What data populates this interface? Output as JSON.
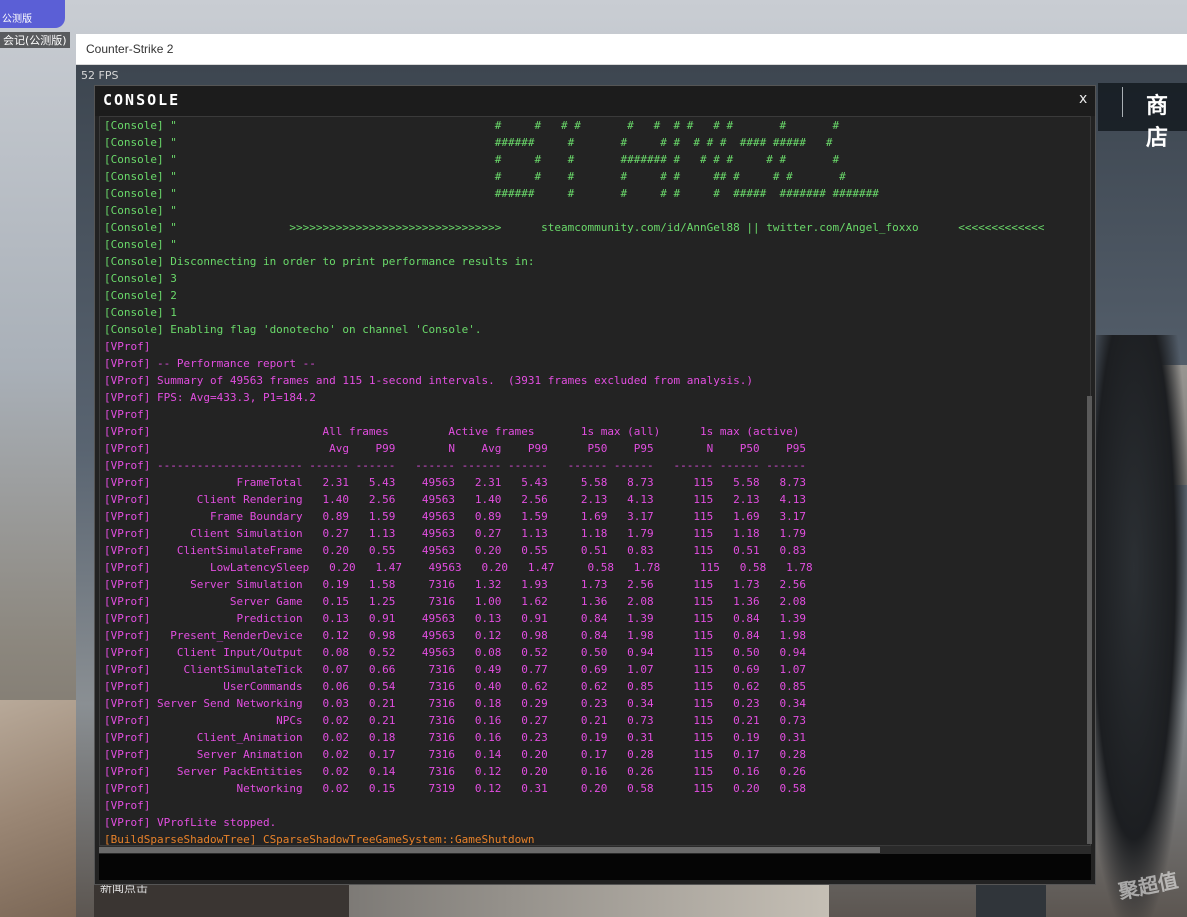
{
  "desktop": {
    "icon_sub_label": "公测版",
    "icon_label": "会记(公测版)"
  },
  "window": {
    "title": "Counter-Strike 2"
  },
  "game": {
    "fps": "52 FPS",
    "store_label": "商店",
    "news_text": "新闻点击",
    "watermark": "聚超值"
  },
  "console": {
    "title": "CONSOLE",
    "close_label": "x",
    "colors": {
      "console_text": "#6ad96a",
      "vprof_text": "#e24ee0",
      "build_text": "#e8822a",
      "background": "#232323"
    },
    "lines": [
      {
        "t": "[Console] \"                                                #     #   # #       #   #  # #   # #       #       #",
        "c": "#6ad96a"
      },
      {
        "t": "[Console] \"                                                ######     #       #     # #  # # #  #### #####   #",
        "c": "#6ad96a"
      },
      {
        "t": "[Console] \"                                                #     #    #       ####### #   # # #     # #       #",
        "c": "#6ad96a"
      },
      {
        "t": "[Console] \"                                                #     #    #       #     # #     ## #     # #       #",
        "c": "#6ad96a"
      },
      {
        "t": "[Console] \"                                                ######     #       #     # #     #  #####  ####### #######",
        "c": "#6ad96a"
      },
      {
        "t": "[Console] \"",
        "c": "#6ad96a"
      },
      {
        "t": "[Console] \"                 >>>>>>>>>>>>>>>>>>>>>>>>>>>>>>>>      steamcommunity.com/id/AnnGel88 || twitter.com/Angel_foxxo      <<<<<<<<<<<<<",
        "c": "#6ad96a"
      },
      {
        "t": "[Console] \"",
        "c": "#6ad96a"
      },
      {
        "t": "[Console] Disconnecting in order to print performance results in:",
        "c": "#6ad96a"
      },
      {
        "t": "[Console] 3",
        "c": "#6ad96a"
      },
      {
        "t": "[Console] 2",
        "c": "#6ad96a"
      },
      {
        "t": "[Console] 1",
        "c": "#6ad96a"
      },
      {
        "t": "[Console] Enabling flag 'donotecho' on channel 'Console'.",
        "c": "#6ad96a"
      },
      {
        "t": "[VProf]",
        "c": "#e24ee0"
      },
      {
        "t": "[VProf] -- Performance report --",
        "c": "#e24ee0"
      },
      {
        "t": "[VProf] Summary of 49563 frames and 115 1-second intervals.  (3931 frames excluded from analysis.)",
        "c": "#e24ee0"
      },
      {
        "t": "[VProf] FPS: Avg=433.3, P1=184.2",
        "c": "#e24ee0"
      },
      {
        "t": "[VProf]",
        "c": "#e24ee0"
      },
      {
        "t": "[VProf]                          All frames         Active frames       1s max (all)      1s max (active)",
        "c": "#e24ee0"
      },
      {
        "t": "[VProf]                           Avg    P99        N    Avg    P99      P50    P95        N    P50    P95",
        "c": "#e24ee0"
      },
      {
        "t": "[VProf] ---------------------- ------ ------   ------ ------ ------   ------ ------   ------ ------ ------",
        "c": "#e24ee0"
      },
      {
        "t": "[VProf]             FrameTotal   2.31   5.43    49563   2.31   5.43     5.58   8.73      115   5.58   8.73",
        "c": "#e24ee0"
      },
      {
        "t": "[VProf]       Client Rendering   1.40   2.56    49563   1.40   2.56     2.13   4.13      115   2.13   4.13",
        "c": "#e24ee0"
      },
      {
        "t": "[VProf]         Frame Boundary   0.89   1.59    49563   0.89   1.59     1.69   3.17      115   1.69   3.17",
        "c": "#e24ee0"
      },
      {
        "t": "[VProf]      Client Simulation   0.27   1.13    49563   0.27   1.13     1.18   1.79      115   1.18   1.79",
        "c": "#e24ee0"
      },
      {
        "t": "[VProf]    ClientSimulateFrame   0.20   0.55    49563   0.20   0.55     0.51   0.83      115   0.51   0.83",
        "c": "#e24ee0"
      },
      {
        "t": "[VProf]         LowLatencySleep   0.20   1.47    49563   0.20   1.47     0.58   1.78      115   0.58   1.78",
        "c": "#e24ee0"
      },
      {
        "t": "[VProf]      Server Simulation   0.19   1.58     7316   1.32   1.93     1.73   2.56      115   1.73   2.56",
        "c": "#e24ee0"
      },
      {
        "t": "[VProf]            Server Game   0.15   1.25     7316   1.00   1.62     1.36   2.08      115   1.36   2.08",
        "c": "#e24ee0"
      },
      {
        "t": "[VProf]             Prediction   0.13   0.91    49563   0.13   0.91     0.84   1.39      115   0.84   1.39",
        "c": "#e24ee0"
      },
      {
        "t": "[VProf]   Present_RenderDevice   0.12   0.98    49563   0.12   0.98     0.84   1.98      115   0.84   1.98",
        "c": "#e24ee0"
      },
      {
        "t": "[VProf]    Client Input/Output   0.08   0.52    49563   0.08   0.52     0.50   0.94      115   0.50   0.94",
        "c": "#e24ee0"
      },
      {
        "t": "[VProf]     ClientSimulateTick   0.07   0.66     7316   0.49   0.77     0.69   1.07      115   0.69   1.07",
        "c": "#e24ee0"
      },
      {
        "t": "[VProf]           UserCommands   0.06   0.54     7316   0.40   0.62     0.62   0.85      115   0.62   0.85",
        "c": "#e24ee0"
      },
      {
        "t": "[VProf] Server Send Networking   0.03   0.21     7316   0.18   0.29     0.23   0.34      115   0.23   0.34",
        "c": "#e24ee0"
      },
      {
        "t": "[VProf]                   NPCs   0.02   0.21     7316   0.16   0.27     0.21   0.73      115   0.21   0.73",
        "c": "#e24ee0"
      },
      {
        "t": "[VProf]       Client_Animation   0.02   0.18     7316   0.16   0.23     0.19   0.31      115   0.19   0.31",
        "c": "#e24ee0"
      },
      {
        "t": "[VProf]       Server Animation   0.02   0.17     7316   0.14   0.20     0.17   0.28      115   0.17   0.28",
        "c": "#e24ee0"
      },
      {
        "t": "[VProf]    Server PackEntities   0.02   0.14     7316   0.12   0.20     0.16   0.26      115   0.16   0.26",
        "c": "#e24ee0"
      },
      {
        "t": "[VProf]             Networking   0.02   0.15     7319   0.12   0.31     0.20   0.58      115   0.20   0.58",
        "c": "#e24ee0"
      },
      {
        "t": "[VProf]",
        "c": "#e24ee0"
      },
      {
        "t": "[VProf] VProfLite stopped.",
        "c": "#e24ee0"
      },
      {
        "t": "[BuildSparseShadowTree] CSparseShadowTreeGameSystem::GameShutdown",
        "c": "#e8822a"
      }
    ],
    "input_value": ""
  }
}
